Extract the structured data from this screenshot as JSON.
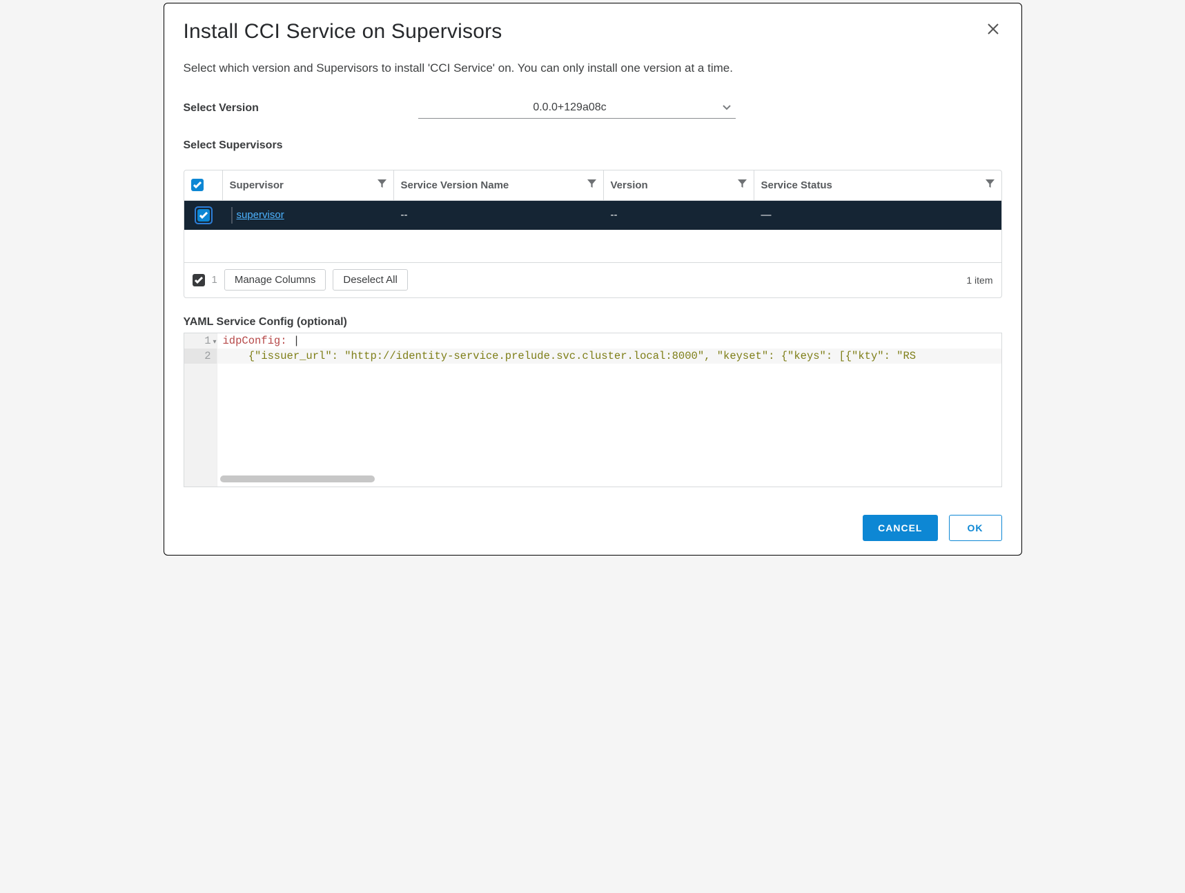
{
  "dialog": {
    "title": "Install CCI Service on Supervisors",
    "description": "Select which version and Supervisors to install 'CCI Service' on. You can only install one version at a time."
  },
  "version": {
    "label": "Select Version",
    "selected": "0.0.0+129a08c"
  },
  "supervisors": {
    "label": "Select Supervisors",
    "columns": {
      "supervisor": "Supervisor",
      "service_version_name": "Service Version Name",
      "version": "Version",
      "service_status": "Service Status"
    },
    "rows": [
      {
        "name": "supervisor",
        "service_version_name": "--",
        "version": "--",
        "service_status": "—",
        "checked": true
      }
    ],
    "selected_count": "1",
    "manage_columns": "Manage Columns",
    "deselect_all": "Deselect All",
    "item_count": "1 item"
  },
  "yaml": {
    "label": "YAML Service Config (optional)",
    "lines": [
      {
        "n": "1",
        "key": "idpConfig:",
        "tail": " |"
      },
      {
        "n": "2",
        "indent": "    ",
        "content": "{\"issuer_url\": \"http://identity-service.prelude.svc.cluster.local:8000\", \"keyset\": {\"keys\": [{\"kty\": \"RS"
      }
    ]
  },
  "footer": {
    "cancel": "CANCEL",
    "ok": "OK"
  }
}
